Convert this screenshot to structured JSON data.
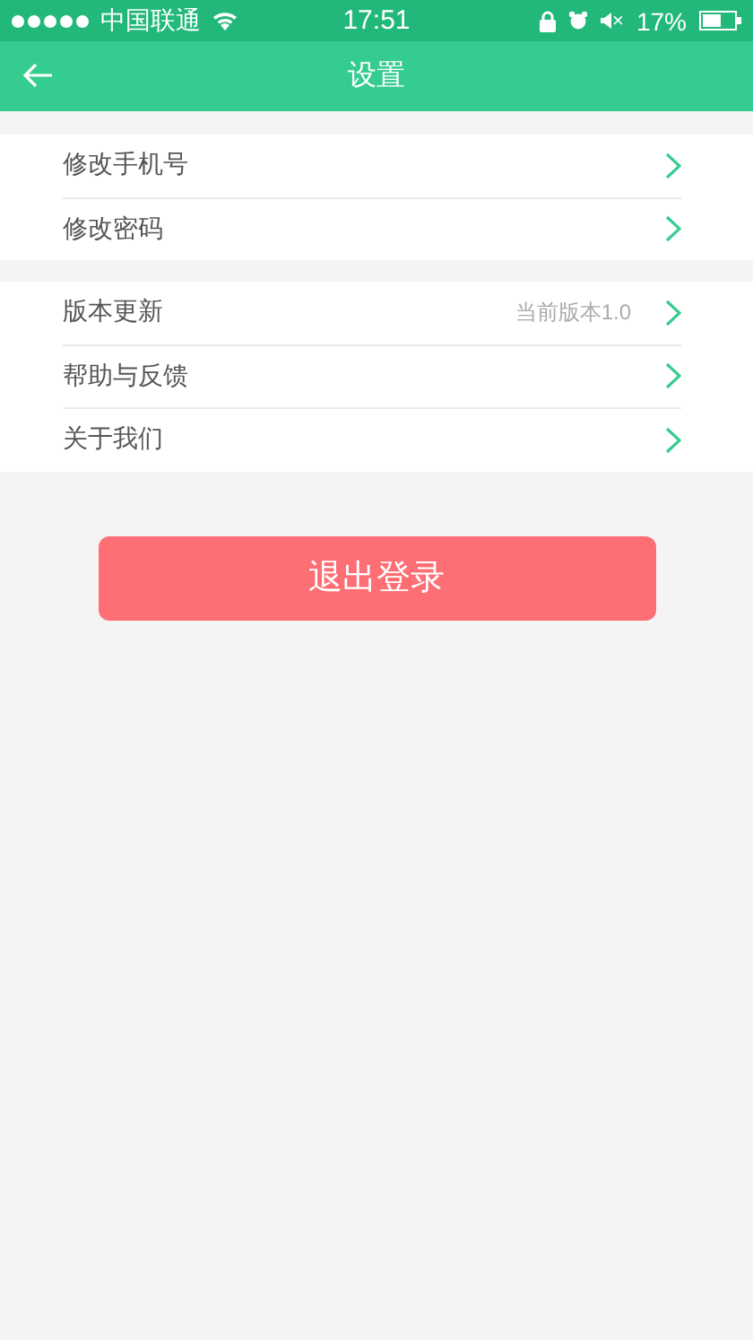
{
  "status_bar": {
    "carrier": "中国联通",
    "time": "17:51",
    "mute_mark": "×",
    "battery_text": "17%"
  },
  "nav_bar": {
    "title": "设置"
  },
  "groups": [
    {
      "items": [
        {
          "label": "修改手机号"
        },
        {
          "label": "修改密码"
        }
      ]
    },
    {
      "items": [
        {
          "label": "版本更新",
          "detail": "当前版本1.0"
        },
        {
          "label": "帮助与反馈"
        },
        {
          "label": "关于我们"
        }
      ]
    }
  ],
  "logout_button": {
    "label": "退出登录"
  }
}
